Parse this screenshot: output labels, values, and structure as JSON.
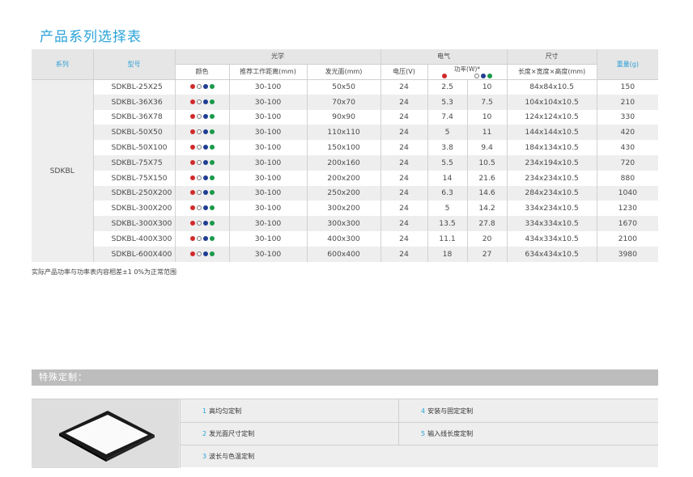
{
  "title": "产品系列选择表",
  "table": {
    "headers": {
      "series": "系列",
      "model": "型号",
      "optics": "光学",
      "electric": "电气",
      "size": "尺寸",
      "weight": "重量(g)",
      "color": "颜色",
      "distance": "推荐工作距离(mm)",
      "emit": "发光面(mm)",
      "voltage": "电压(V)",
      "power": "功率(W)*",
      "dims": "长度×宽度×高度(mm)"
    },
    "series_name": "SDKBL",
    "rows": [
      {
        "model": "SDKBL-25X25",
        "distance": "30-100",
        "emit": "50x50",
        "voltage": "24",
        "p_red": "2.5",
        "p_other": "10",
        "dims": "84x84x10.5",
        "weight": "150"
      },
      {
        "model": "SDKBL-36X36",
        "distance": "30-100",
        "emit": "70x70",
        "voltage": "24",
        "p_red": "5.3",
        "p_other": "7.5",
        "dims": "104x104x10.5",
        "weight": "210"
      },
      {
        "model": "SDKBL-36X78",
        "distance": "30-100",
        "emit": "90x90",
        "voltage": "24",
        "p_red": "7.4",
        "p_other": "10",
        "dims": "124x124x10.5",
        "weight": "330"
      },
      {
        "model": "SDKBL-50X50",
        "distance": "30-100",
        "emit": "110x110",
        "voltage": "24",
        "p_red": "5",
        "p_other": "11",
        "dims": "144x144x10.5",
        "weight": "420"
      },
      {
        "model": "SDKBL-50X100",
        "distance": "30-100",
        "emit": "150x100",
        "voltage": "24",
        "p_red": "3.8",
        "p_other": "9.4",
        "dims": "184x134x10.5",
        "weight": "430"
      },
      {
        "model": "SDKBL-75X75",
        "distance": "30-100",
        "emit": "200x160",
        "voltage": "24",
        "p_red": "5.5",
        "p_other": "10.5",
        "dims": "234x194x10.5",
        "weight": "720"
      },
      {
        "model": "SDKBL-75X150",
        "distance": "30-100",
        "emit": "200x200",
        "voltage": "24",
        "p_red": "14",
        "p_other": "21.6",
        "dims": "234x234x10.5",
        "weight": "880"
      },
      {
        "model": "SDKBL-250X200",
        "distance": "30-100",
        "emit": "250x200",
        "voltage": "24",
        "p_red": "6.3",
        "p_other": "14.6",
        "dims": "284x234x10.5",
        "weight": "1040"
      },
      {
        "model": "SDKBL-300X200",
        "distance": "30-100",
        "emit": "300x200",
        "voltage": "24",
        "p_red": "5",
        "p_other": "14.2",
        "dims": "334x234x10.5",
        "weight": "1230"
      },
      {
        "model": "SDKBL-300X300",
        "distance": "30-100",
        "emit": "300x300",
        "voltage": "24",
        "p_red": "13.5",
        "p_other": "27.8",
        "dims": "334x334x10.5",
        "weight": "1670"
      },
      {
        "model": "SDKBL-400X300",
        "distance": "30-100",
        "emit": "400x300",
        "voltage": "24",
        "p_red": "11.1",
        "p_other": "20",
        "dims": "434x334x10.5",
        "weight": "2100"
      },
      {
        "model": "SDKBL-600X400",
        "distance": "30-100",
        "emit": "600x400",
        "voltage": "24",
        "p_red": "18",
        "p_other": "27",
        "dims": "634x434x10.5",
        "weight": "3980"
      }
    ]
  },
  "colors": {
    "accent": "#2aa3d8",
    "red": "#d12a2a",
    "white": "#ffffff",
    "blue": "#1f3d92",
    "green": "#1a9a4a"
  },
  "note": "实际产品功率与功率表内容相差±1 0%为正常范围",
  "custom": {
    "heading": "特殊定制：",
    "options": [
      {
        "num": "1",
        "label": "高均匀定制"
      },
      {
        "num": "2",
        "label": "发光面尺寸定制"
      },
      {
        "num": "3",
        "label": "波长与色温定制"
      },
      {
        "num": "4",
        "label": "安装与固定定制"
      },
      {
        "num": "5",
        "label": "输入线长度定制"
      }
    ]
  }
}
